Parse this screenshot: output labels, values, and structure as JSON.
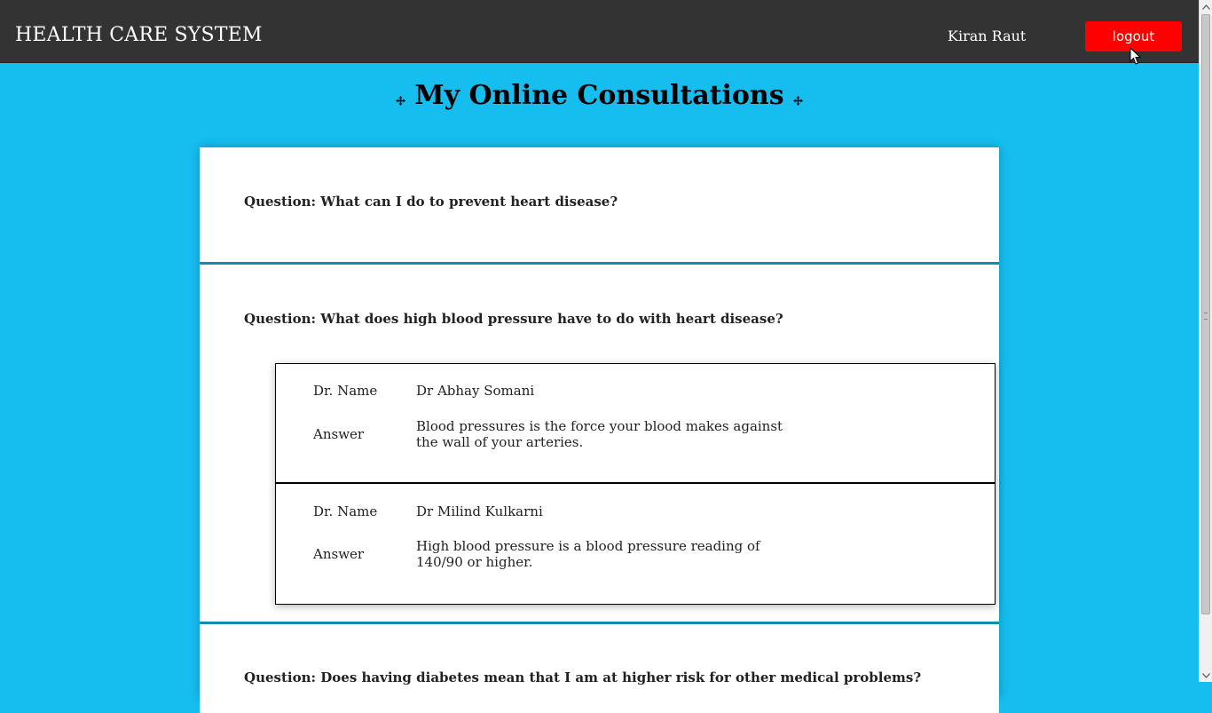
{
  "header": {
    "brand": "HEALTH CARE SYSTEM",
    "user_name": "Kiran Raut",
    "logout_label": "logout"
  },
  "page": {
    "title": "My Online Consultations"
  },
  "consultations": [
    {
      "question": "Question: What can I do to prevent heart disease?",
      "answers": []
    },
    {
      "question": "Question: What does high blood pressure have to do with heart disease?",
      "answers": [
        {
          "doctor_label": "Dr. Name",
          "doctor": "Dr Abhay Somani",
          "answer_label": "Answer",
          "answer": "Blood pressures is the force your blood makes against the wall of your arteries."
        },
        {
          "doctor_label": "Dr. Name",
          "doctor": "Dr Milind Kulkarni",
          "answer_label": "Answer",
          "answer": "High blood pressure is a blood pressure reading of 140/90 or higher."
        }
      ]
    },
    {
      "question": "Question: Does having diabetes mean that I am at higher risk for other medical problems?",
      "answers": []
    }
  ],
  "colors": {
    "background": "#16bdef",
    "navbar": "#333333",
    "logout_button": "#ff0000",
    "divider": "#138bb0"
  },
  "icons": {
    "heading_decor": "move-icon",
    "cursor": "mouse-pointer-icon"
  }
}
